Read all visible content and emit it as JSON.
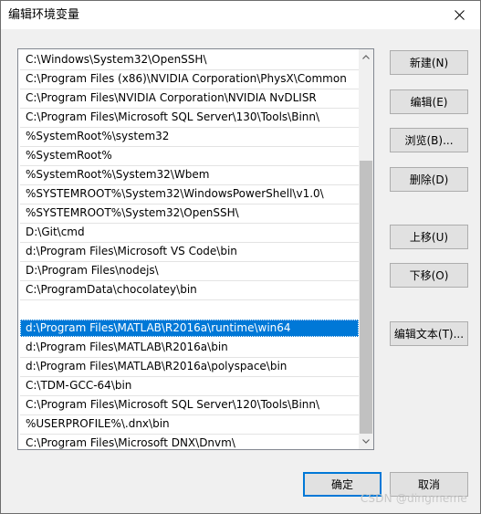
{
  "window": {
    "title": "编辑环境变量"
  },
  "list": {
    "selected_index": 14,
    "items": [
      "C:\\Windows\\System32\\OpenSSH\\",
      "C:\\Program Files (x86)\\NVIDIA Corporation\\PhysX\\Common",
      "C:\\Program Files\\NVIDIA Corporation\\NVIDIA NvDLISR",
      "C:\\Program Files\\Microsoft SQL Server\\130\\Tools\\Binn\\",
      "%SystemRoot%\\system32",
      "%SystemRoot%",
      "%SystemRoot%\\System32\\Wbem",
      "%SYSTEMROOT%\\System32\\WindowsPowerShell\\v1.0\\",
      "%SYSTEMROOT%\\System32\\OpenSSH\\",
      "D:\\Git\\cmd",
      "d:\\Program Files\\Microsoft VS Code\\bin",
      "D:\\Program Files\\nodejs\\",
      "C:\\ProgramData\\chocolatey\\bin",
      "",
      "d:\\Program Files\\MATLAB\\R2016a\\runtime\\win64",
      "d:\\Program Files\\MATLAB\\R2016a\\bin",
      "d:\\Program Files\\MATLAB\\R2016a\\polyspace\\bin",
      "C:\\TDM-GCC-64\\bin",
      "C:\\Program Files\\Microsoft SQL Server\\120\\Tools\\Binn\\",
      "%USERPROFILE%\\.dnx\\bin",
      "C:\\Program Files\\Microsoft DNX\\Dnvm\\"
    ]
  },
  "buttons": {
    "new": "新建(N)",
    "edit": "编辑(E)",
    "browse": "浏览(B)...",
    "delete": "删除(D)",
    "move_up": "上移(U)",
    "move_down": "下移(O)",
    "edit_text": "编辑文本(T)...",
    "ok": "确定",
    "cancel": "取消"
  },
  "watermark": "CSDN @dingmeme",
  "icons": {
    "close": "close-icon",
    "scroll_up": "chevron-up-icon",
    "scroll_down": "chevron-down-icon"
  },
  "colors": {
    "selection": "#0078d7",
    "default_button_border": "#0078d7"
  }
}
